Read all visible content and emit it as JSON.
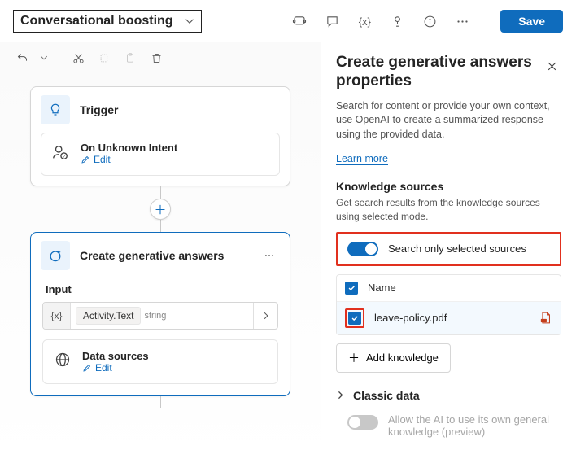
{
  "topbar": {
    "title": "Conversational boosting",
    "save_label": "Save"
  },
  "trigger_card": {
    "title": "Trigger",
    "intent_name": "On Unknown Intent",
    "edit_label": "Edit"
  },
  "gen_card": {
    "title": "Create generative answers",
    "input_label": "Input",
    "input_value": "Activity.Text",
    "input_type": "string",
    "data_sources_label": "Data sources",
    "ds_edit_label": "Edit"
  },
  "panel": {
    "title": "Create generative answers properties",
    "description": "Search for content or provide your own context, use OpenAI to create a summarized response using the provided data.",
    "learn_more": "Learn more",
    "ks_heading": "Knowledge sources",
    "ks_desc": "Get search results from the knowledge sources using selected mode.",
    "toggle_label": "Search only selected sources",
    "col_name": "Name",
    "source_name": "leave-policy.pdf",
    "add_knowledge": "Add knowledge",
    "classic_heading": "Classic data",
    "ai_toggle_label": "Allow the AI to use its own general knowledge (preview)"
  }
}
